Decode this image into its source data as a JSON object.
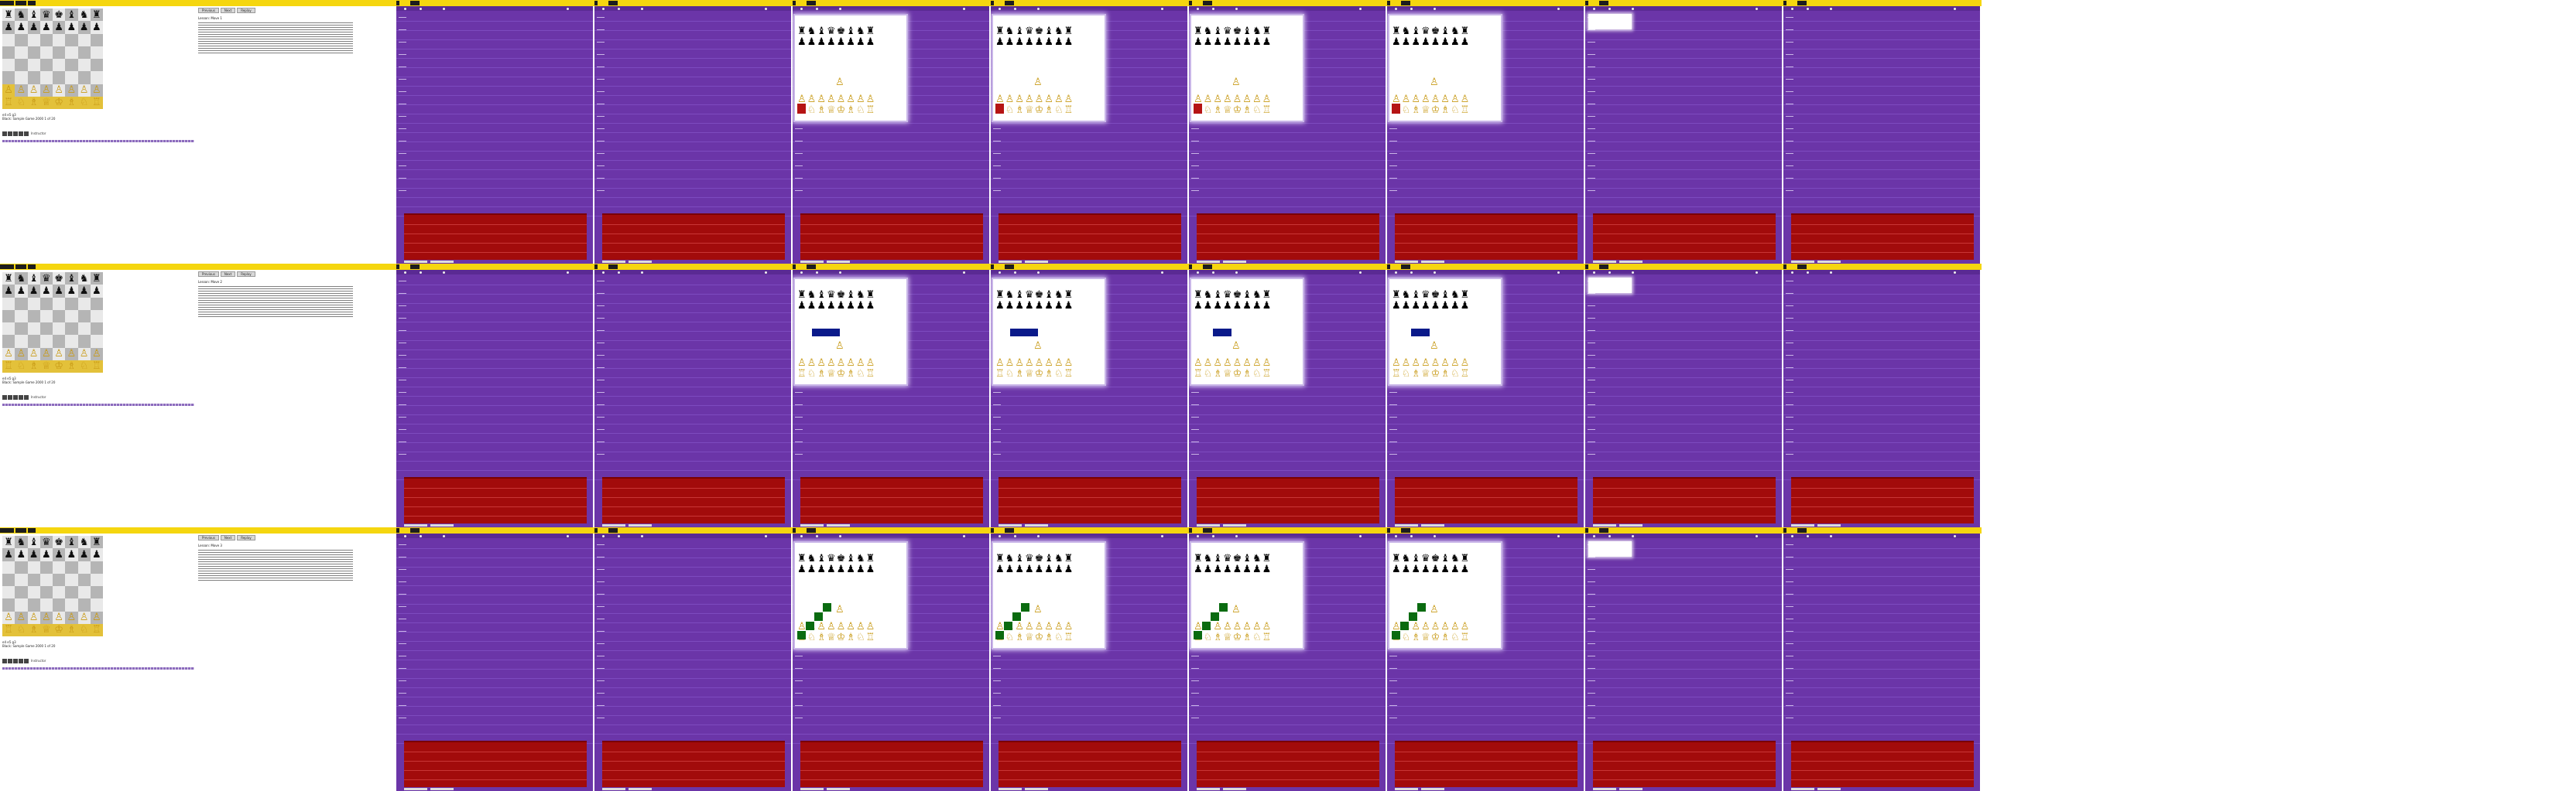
{
  "colors": {
    "accent_bar": "#f5d60f",
    "video_bg": "#6b35a8",
    "red_panel": "#a20b0b",
    "move_blue": "#0a1a8a",
    "move_green": "#0a6b10",
    "highlight": "#e3c13a"
  },
  "board": {
    "rows": [
      [
        "♜",
        "♞",
        "♝",
        "♛",
        "♚",
        "♝",
        "♞",
        "♜"
      ],
      [
        "♟",
        "♟",
        "♟",
        "♟",
        "♟",
        "♟",
        "♟",
        "♟"
      ],
      [
        "",
        "",
        "",
        "",
        "",
        "",
        "",
        ""
      ],
      [
        "",
        "",
        "",
        "",
        "",
        "",
        "",
        ""
      ],
      [
        "",
        "",
        "",
        "",
        "",
        "",
        "",
        ""
      ],
      [
        "",
        "",
        "",
        "",
        "",
        "",
        "",
        ""
      ],
      [
        "♙",
        "♙",
        "♙",
        "♙",
        "♙",
        "♙",
        "♙",
        "♙"
      ],
      [
        "♖",
        "♘",
        "♗",
        "♕",
        "♔",
        "♗",
        "♘",
        "♖"
      ]
    ]
  },
  "rows": [
    {
      "info_line1": "e4 e5 g3",
      "info_line2": "Black: Sample Game 2000  1 of 20",
      "controls_label": "Instructor",
      "lesson_buttons": [
        "Previous",
        "Next",
        "Replay"
      ],
      "lesson_head": "Lesson: Move 1",
      "overlay": "red"
    },
    {
      "info_line1": "e4 e5 g3",
      "info_line2": "Black: Sample Game 2000  1 of 20",
      "controls_label": "Instructor",
      "lesson_buttons": [
        "Previous",
        "Next",
        "Replay"
      ],
      "lesson_head": "Lesson: Move 2",
      "overlay": "blue"
    },
    {
      "info_line1": "e4 e5 g3",
      "info_line2": "Black: Sample Game 2000  1 of 20",
      "controls_label": "Instructor",
      "lesson_buttons": [
        "Previous",
        "Next",
        "Replay"
      ],
      "lesson_head": "Lesson: Move 3",
      "overlay": "green"
    }
  ]
}
